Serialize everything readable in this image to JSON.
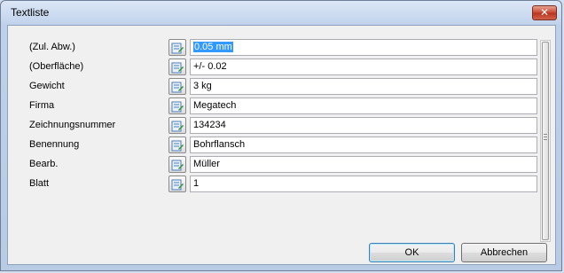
{
  "window": {
    "title": "Textliste",
    "close_label": "✕"
  },
  "rows": [
    {
      "label": "(Zul. Abw.)",
      "value": "0.05 mm",
      "selected": true
    },
    {
      "label": "(Oberfläche)",
      "value": "+/- 0.02"
    },
    {
      "label": "Gewicht",
      "value": "3 kg"
    },
    {
      "label": "Firma",
      "value": "Megatech"
    },
    {
      "label": "Zeichnungsnummer",
      "value": "134234"
    },
    {
      "label": "Benennung",
      "value": "Bohrflansch"
    },
    {
      "label": "Bearb.",
      "value": "Müller"
    },
    {
      "label": "Blatt",
      "value": "1"
    }
  ],
  "row_icon": "edit-text-icon",
  "buttons": {
    "ok": "OK",
    "cancel": "Abbrechen"
  },
  "colors": {
    "selection": "#3399ff",
    "close_button": "#c9462f"
  }
}
